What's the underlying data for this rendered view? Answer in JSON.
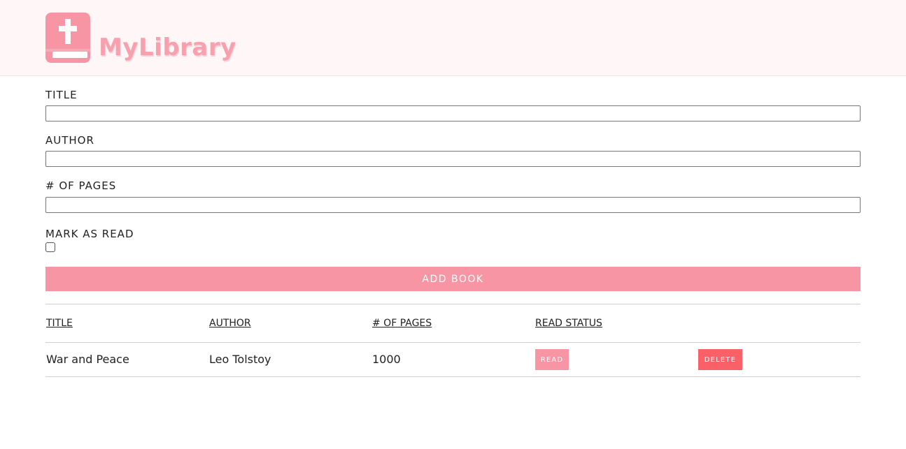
{
  "header": {
    "logo_text": "MyLibrary",
    "logo_icon": "bible-book-icon",
    "background": "#fff7f7",
    "brand_color": "#f8a0ad"
  },
  "form": {
    "title_label": "TITLE",
    "title_value": "",
    "author_label": "AUTHOR",
    "author_value": "",
    "pages_label": "# OF PAGES",
    "pages_value": "",
    "read_label": "MARK AS READ",
    "read_checked": false,
    "add_button": "ADD BOOK",
    "add_button_color": "#f895a5"
  },
  "table": {
    "headers": [
      "TITLE",
      "AUTHOR",
      "# OF PAGES",
      "READ STATUS"
    ],
    "rows": [
      {
        "title": "War and Peace",
        "author": "Leo Tolstoy",
        "pages": "1000",
        "read_button": "READ",
        "delete_button": "DELETE"
      }
    ],
    "delete_color": "#fa6068"
  }
}
